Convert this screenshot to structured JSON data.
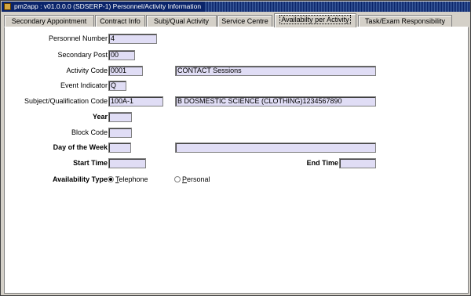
{
  "window": {
    "title": "pm2app : v01.0.0.0 (SDSERP-1) Personnel/Activity Information"
  },
  "tabs": [
    {
      "label": "Secondary Appointment"
    },
    {
      "label": "Contract Info"
    },
    {
      "label": "Subj/Qual Activity"
    },
    {
      "label": "Service Centre"
    },
    {
      "label": "Availabilty per Activity"
    },
    {
      "label": "Task/Exam Responsibility"
    }
  ],
  "form": {
    "personnel_number": {
      "label": "Personnel Number",
      "value": "4"
    },
    "secondary_post": {
      "label": "Secondary Post",
      "value": "00"
    },
    "activity_code": {
      "label": "Activity Code",
      "value": "0001",
      "description": "CONTACT Sessions"
    },
    "event_indicator": {
      "label": "Event Indicator",
      "value": "Q"
    },
    "subject_qualification_code": {
      "label": "Subject/Qualification Code",
      "value": "100A-1",
      "description": "B DOSMESTIC SCIENCE (CLOTHING)1234567890"
    },
    "year": {
      "label": "Year",
      "value": ""
    },
    "block_code": {
      "label": "Block Code",
      "value": ""
    },
    "day_of_week": {
      "label": "Day of the Week",
      "value": "",
      "description": ""
    },
    "start_time": {
      "label": "Start Time",
      "value": ""
    },
    "end_time": {
      "label": "End Time",
      "value": ""
    },
    "availability_type": {
      "label": "Availability Type",
      "options": [
        {
          "label_first": "T",
          "label_rest": "elephone",
          "selected": true
        },
        {
          "label_first": "P",
          "label_rest": "ersonal",
          "selected": false
        }
      ]
    }
  },
  "colors": {
    "field_bg": "#e0ddf5",
    "title_bg": "#0a246a",
    "window_bg": "#d4d0c8"
  }
}
